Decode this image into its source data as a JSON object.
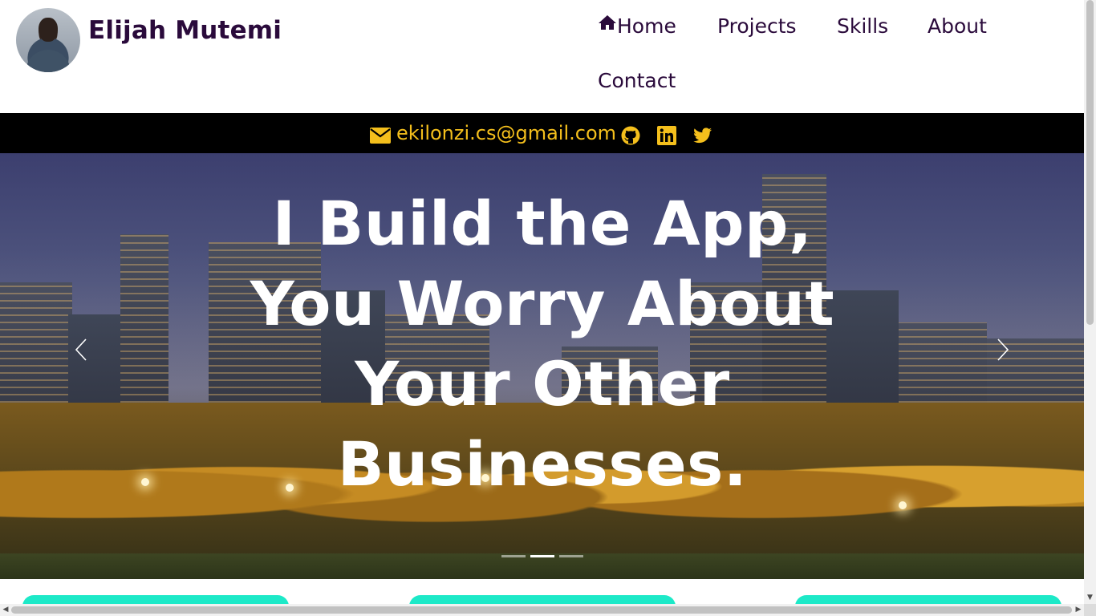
{
  "header": {
    "brand_name": "Elijah Mutemi",
    "nav": {
      "home": "Home",
      "projects": "Projects",
      "skills": "Skills",
      "about": "About",
      "contact": "Contact"
    }
  },
  "contact_bar": {
    "email": "ekilonzi.cs@gmail.com",
    "icons": [
      "envelope-icon",
      "github-icon",
      "linkedin-icon",
      "twitter-icon"
    ],
    "accent_color": "#f4bf1c"
  },
  "hero": {
    "heading": "I Build the App, You Worry About Your Other Businesses.",
    "active_slide": 2,
    "slide_count": 3
  },
  "colors": {
    "brand_text": "#2a0a3b",
    "contact_bar_bg": "#000000",
    "card_accent": "#1de9c8"
  }
}
